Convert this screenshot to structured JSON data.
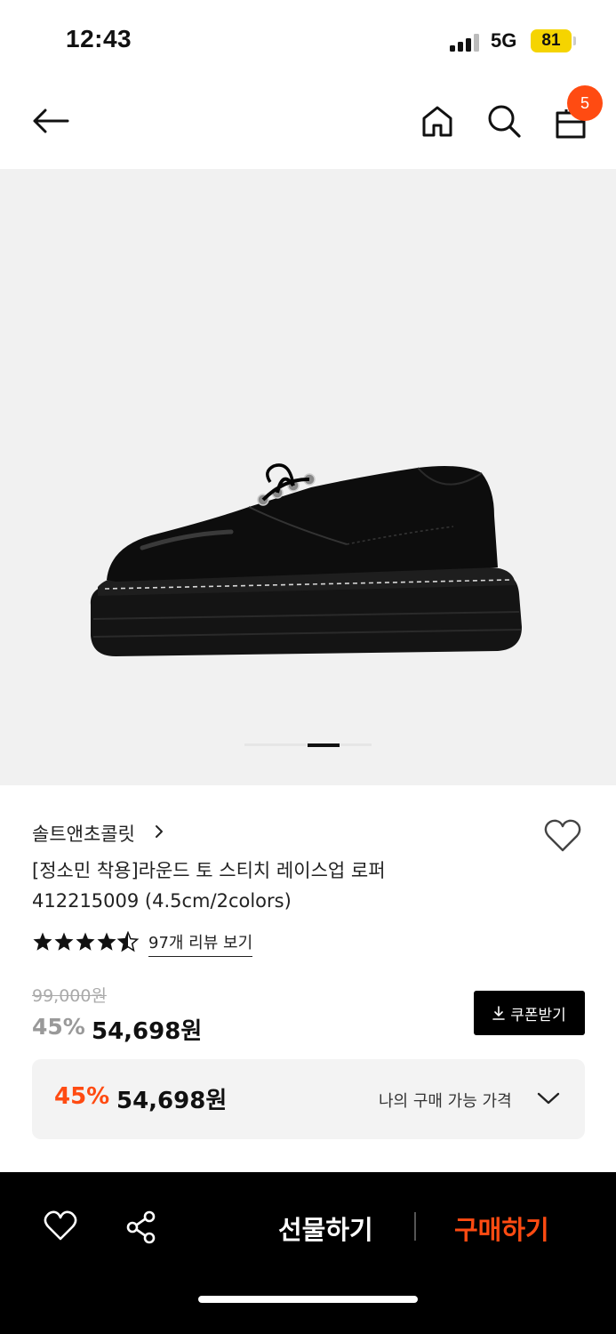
{
  "status": {
    "time": "12:43",
    "network": "5G",
    "battery": "81"
  },
  "header": {
    "back_icon": "arrow-left-icon",
    "home_icon": "home-icon",
    "search_icon": "search-icon",
    "cart_icon": "shopping-bag-icon",
    "cart_count": "5"
  },
  "gallery": {
    "image_alt": "black lace-up loafer",
    "pages": 3,
    "active_page": 2
  },
  "product": {
    "brand": "솔트앤초콜릿",
    "title_line1": "[정소민 착용]라운드 토 스티치 레이스업 로퍼",
    "title_line2": "412215009 (4.5cm/2colors)",
    "rating": 4.5,
    "review_link": "97개 리뷰 보기",
    "original_price": "99,000원",
    "discount": "45%",
    "sale_price": "54,698원",
    "coupon_label": "쿠폰받기"
  },
  "my_price": {
    "discount": "45%",
    "price": "54,698원",
    "label": "나의 구매 가능 가격"
  },
  "bottom_bar": {
    "gift_label": "선물하기",
    "buy_label": "구매하기"
  },
  "colors": {
    "accent": "#ff4b12",
    "battery": "#f5d400",
    "gallery_bg": "#f1f1f1"
  }
}
